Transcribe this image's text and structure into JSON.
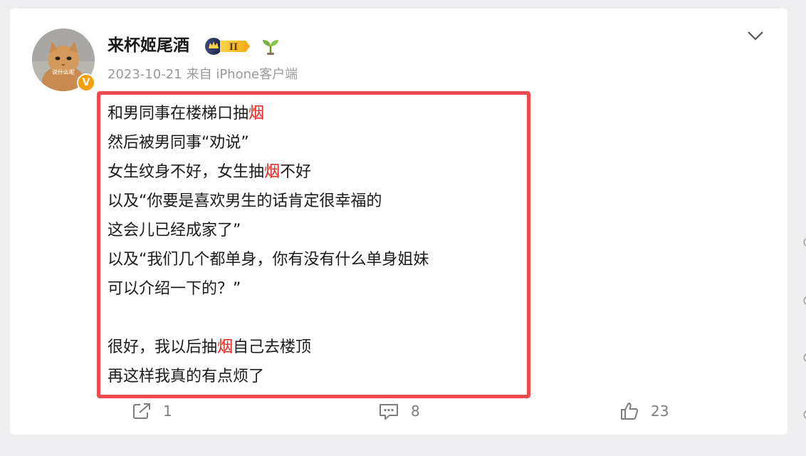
{
  "post": {
    "author": "来杯姬尾酒",
    "avatar_caption": "说什么呢",
    "verified_mark": "V",
    "level_badge": "II",
    "date": "2023-10-21",
    "source": "来自 iPhone客户端",
    "lines": [
      [
        {
          "text": "和男同事在楼梯口抽"
        },
        {
          "text": "烟",
          "highlight": true
        }
      ],
      [
        {
          "text": "然后被男同事“劝说”"
        }
      ],
      [
        {
          "text": "女生纹身不好，女生抽"
        },
        {
          "text": "烟",
          "highlight": true
        },
        {
          "text": "不好"
        }
      ],
      [
        {
          "text": "以及“你要是喜欢男生的话肯定很幸福的"
        }
      ],
      [
        {
          "text": "这会儿已经成家了”"
        }
      ],
      [
        {
          "text": "以及“我们几个都单身，你有没有什么单身姐妹"
        }
      ],
      [
        {
          "text": "可以介绍一下的？”"
        }
      ],
      [
        {
          "text": ""
        }
      ],
      [
        {
          "text": "很好，我以后抽"
        },
        {
          "text": "烟",
          "highlight": true
        },
        {
          "text": "自己去楼顶"
        }
      ],
      [
        {
          "text": "再这样我真的有点烦了"
        }
      ]
    ]
  },
  "actions": {
    "share_count": "1",
    "comment_count": "8",
    "like_count": "23"
  },
  "icons": [
    "chevron-down-icon",
    "share-icon",
    "comment-icon",
    "like-icon",
    "crown-badge-icon",
    "sprout-icon",
    "verified-icon"
  ],
  "colors": {
    "highlight": "#e6231c",
    "highlight_box": "#ef4b4f",
    "verified": "#f49f0a",
    "meta_text": "#9a9a9a",
    "action_text": "#7d7d7d"
  }
}
